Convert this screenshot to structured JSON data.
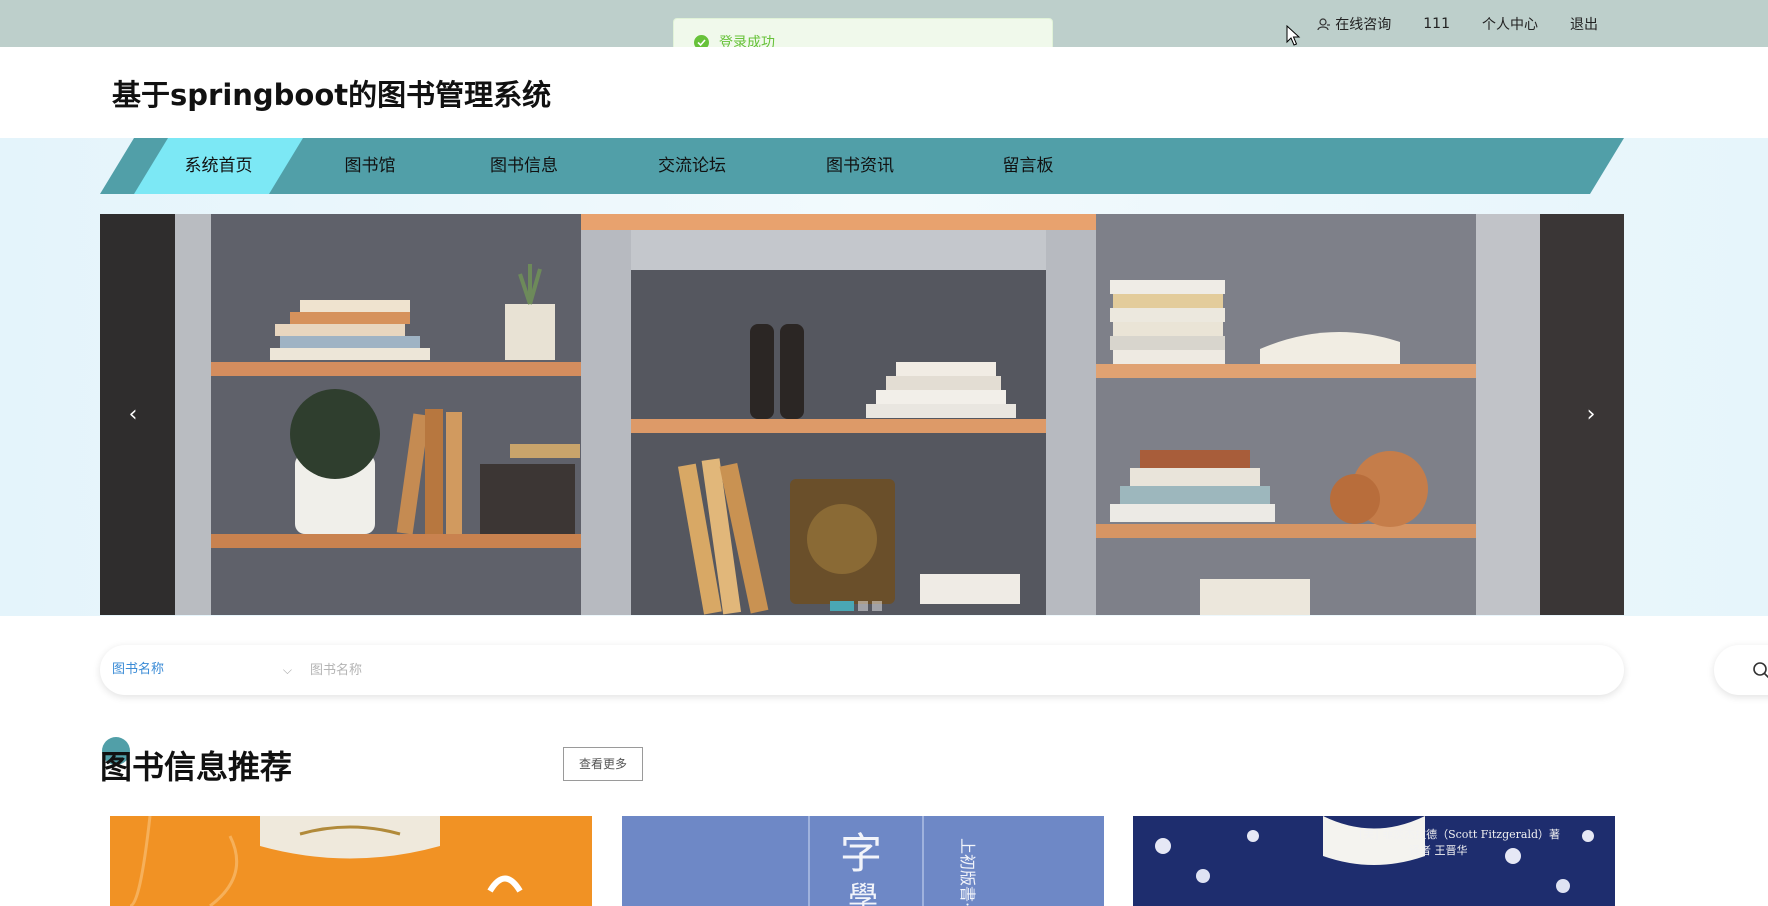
{
  "topbar": {
    "toast": "登录成功",
    "links": [
      "在线咨询",
      "111",
      "个人中心",
      "退出"
    ]
  },
  "header": {
    "title": "基于springboot的图书管理系统"
  },
  "nav": {
    "items": [
      "系统首页",
      "图书馆",
      "图书信息",
      "交流论坛",
      "图书资讯",
      "留言板"
    ],
    "active_index": 0
  },
  "banner": {
    "prev": "‹",
    "next": "›",
    "slide_count": 3,
    "active_slide": 0
  },
  "search": {
    "field": "图书名称",
    "placeholder": "图书名称"
  },
  "section": {
    "title": "图书信息推荐",
    "more": "查看更多"
  },
  "books": [
    {
      "cover": "orange-ornament-cover"
    },
    {
      "cover": "blue-chinese-title-cover",
      "cover_text": [
        "字",
        "上初版書·",
        "學"
      ]
    },
    {
      "cover": "navy-floral-cover",
      "cover_text": [
        "[美] 菲茨杰拉德（Scott Fitzgerald）著",
        "译者 王晋华"
      ]
    }
  ],
  "colors": {
    "topbar": "#bdcfcb",
    "nav": "#519fa8",
    "nav_active": "#7ce8f5",
    "toast_text": "#67c23a"
  }
}
